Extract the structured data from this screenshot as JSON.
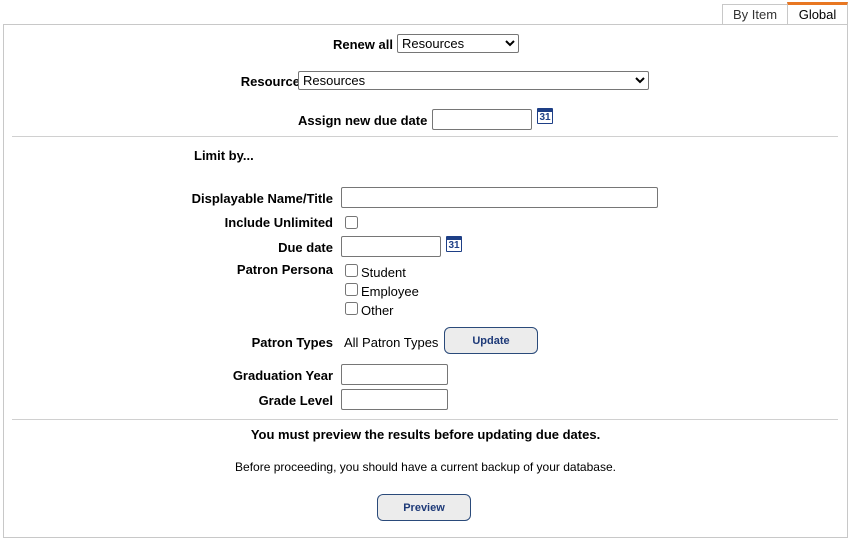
{
  "tabs": [
    {
      "label": "By Item"
    },
    {
      "label": "Global",
      "active": true,
      "accent": "#e87722"
    }
  ],
  "renew_all": {
    "label": "Renew all",
    "value": "Resources"
  },
  "resource_type": {
    "label": "Resource Type",
    "value": "Resources"
  },
  "assign_due": {
    "label": "Assign new due date",
    "value": ""
  },
  "calendar_icon": {
    "icon": "calendar-icon",
    "text": "31"
  },
  "limit_by": "Limit by...",
  "fields": {
    "name_title": {
      "label": "Displayable Name/Title",
      "value": ""
    },
    "include_unlimited": {
      "label": "Include Unlimited",
      "checked": false
    },
    "due_date": {
      "label": "Due date",
      "value": ""
    },
    "patron_persona": {
      "label": "Patron Persona",
      "options": [
        {
          "label": "Student",
          "checked": false
        },
        {
          "label": "Employee",
          "checked": false
        },
        {
          "label": "Other",
          "checked": false
        }
      ]
    },
    "patron_types": {
      "label": "Patron Types",
      "value": "All Patron Types",
      "button": "Update"
    },
    "graduation_year": {
      "label": "Graduation Year",
      "value": ""
    },
    "grade_level": {
      "label": "Grade Level",
      "value": ""
    }
  },
  "notice": "You must preview the results before updating due dates.",
  "backup_note": "Before proceeding, you should have a current backup of your database.",
  "preview_button": "Preview"
}
